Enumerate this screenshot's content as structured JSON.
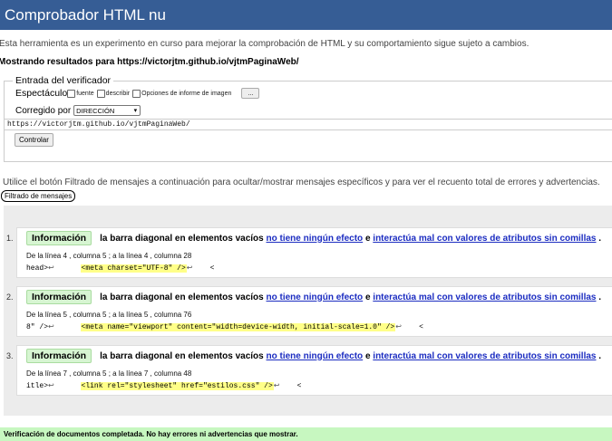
{
  "header": {
    "title": "Comprobador HTML nu"
  },
  "intro": "Esta herramienta es un experimento en curso para mejorar la comprobación de HTML y su comportamiento sigue sujeto a cambios.",
  "showing": "Mostrando resultados para https://victorjtm.github.io/vjtmPaginaWeb/",
  "checker": {
    "legend": "Entrada del verificador",
    "show_label": "Espectáculo",
    "options": [
      "fuente",
      "describir",
      "Opciones de informe de imagen"
    ],
    "dots_button": "...",
    "corrected_label": "Corregido por",
    "select_value": "DIRECCIÓN",
    "url_value": "https://victorjtm.github.io/vjtmPaginaWeb/",
    "check_button": "Controlar"
  },
  "help": "Utilice el botón Filtrado de mensajes a continuación para ocultar/mostrar mensajes específicos y para ver el recuento total de errores y advertencias.",
  "filter_button": "Filtrado de mensajes",
  "messages": [
    {
      "num": "1.",
      "type": "Información",
      "text": "la barra diagonal en elementos vacíos",
      "link1": "no tiene ningún efecto",
      "conj": "e",
      "link2": "interactúa mal con valores de atributos sin comillas",
      "end": ".",
      "loc": "De la línea 4 , columna 5 ; a la línea 4 , columna 28",
      "pre": "head>",
      "code": "<meta charset=\"UTF-8\" />",
      "post": "<"
    },
    {
      "num": "2.",
      "type": "Información",
      "text": "la barra diagonal en elementos vacíos",
      "link1": "no tiene ningún efecto",
      "conj": "e",
      "link2": "interactúa mal con valores de atributos sin comillas",
      "end": ".",
      "loc": "De la línea 5 , columna 5 ; a la línea 5 , columna 76",
      "pre": "8\" />",
      "code": "<meta name=\"viewport\" content=\"width=device-width, initial-scale=1.0\" />",
      "post": "<"
    },
    {
      "num": "3.",
      "type": "Información",
      "text": "la barra diagonal en elementos vacíos",
      "link1": "no tiene ningún efecto",
      "conj": "e",
      "link2": "interactúa mal con valores de atributos sin comillas",
      "end": ".",
      "loc": "De la línea 7 , columna 5 ; a la línea 7 , columna 48",
      "pre": "itle>",
      "code": "<link rel=\"stylesheet\" href=\"estilos.css\" />",
      "post": "<"
    }
  ],
  "footer": "Verificación de documentos completada. No hay errores ni advertencias que mostrar.",
  "icons": {
    "return": "return-arrow-icon"
  },
  "colors": {
    "header": "#365d95",
    "badge": "#d7f5d2",
    "highlight": "#ffff88",
    "footer": "#c7f7c0",
    "link": "#1b2cc1"
  }
}
